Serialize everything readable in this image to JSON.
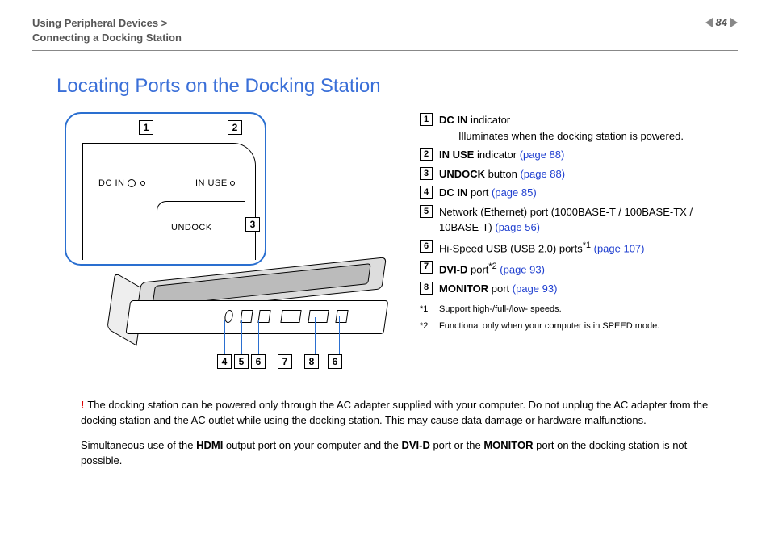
{
  "header": {
    "breadcrumb_line1": "Using Peripheral Devices >",
    "breadcrumb_line2": "Connecting a Docking Station",
    "page_number": "84"
  },
  "title": "Locating Ports on the Docking Station",
  "diagram_labels": {
    "dc_in": "DC IN",
    "in_use": "IN USE",
    "undock": "UNDOCK"
  },
  "callout_numbers": {
    "top1": "1",
    "top2": "2",
    "side3": "3",
    "b4": "4",
    "b5": "5",
    "b6a": "6",
    "b7": "7",
    "b8": "8",
    "b6b": "6"
  },
  "items": [
    {
      "num": "1",
      "label_bold": "DC IN",
      "label_rest": " indicator",
      "desc": "Illuminates when the docking station is powered."
    },
    {
      "num": "2",
      "label_bold": "IN USE",
      "label_rest": " indicator ",
      "link": "(page 88)"
    },
    {
      "num": "3",
      "label_bold": "UNDOCK",
      "label_rest": " button ",
      "link": "(page 88)"
    },
    {
      "num": "4",
      "label_bold": "DC IN",
      "label_rest": " port ",
      "link": "(page 85)"
    },
    {
      "num": "5",
      "label_plain": "Network (Ethernet) port (1000BASE-T / 100BASE-TX / 10BASE-T) ",
      "link": "(page 56)"
    },
    {
      "num": "6",
      "label_plain": "Hi-Speed USB (USB 2.0) ports",
      "sup": "*1",
      "space": " ",
      "link": "(page 107)"
    },
    {
      "num": "7",
      "label_bold": "DVI-D",
      "label_rest": " port",
      "sup": "*2",
      "space": " ",
      "link": "(page 93)"
    },
    {
      "num": "8",
      "label_bold": "MONITOR",
      "label_rest": " port ",
      "link": "(page 93)"
    }
  ],
  "footnotes": [
    {
      "mark": "*1",
      "text": "Support high-/full-/low- speeds."
    },
    {
      "mark": "*2",
      "text": "Functional only when your computer is in SPEED mode."
    }
  ],
  "notes": {
    "warning": "The docking station can be powered only through the AC adapter supplied with your computer. Do not unplug the AC adapter from the docking station and the AC outlet while using the docking station. This may cause data damage or hardware malfunctions.",
    "p2_pre": "Simultaneous use of the ",
    "p2_b1": "HDMI",
    "p2_mid1": " output port on your computer and the ",
    "p2_b2": "DVI-D",
    "p2_mid2": " port or the ",
    "p2_b3": "MONITOR",
    "p2_post": " port on the docking station is not possible."
  }
}
